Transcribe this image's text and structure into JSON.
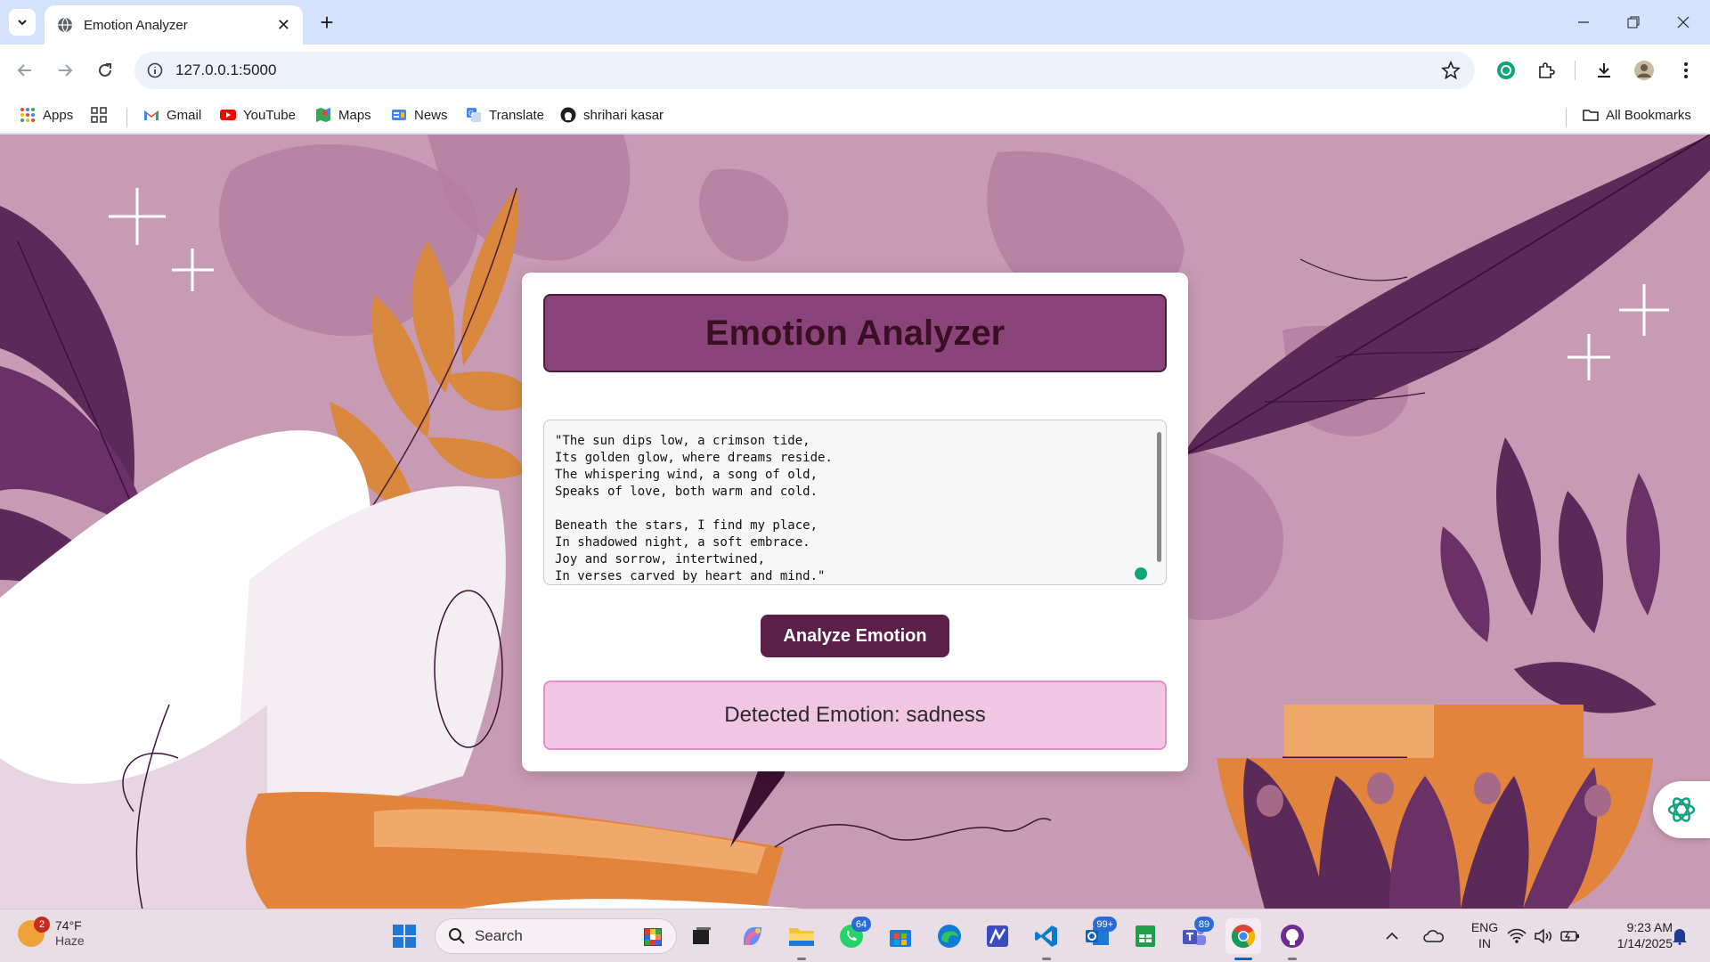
{
  "browser": {
    "tab_title": "Emotion Analyzer",
    "url": "127.0.0.1:5000",
    "bookmarks": [
      {
        "label": "Apps",
        "icon": "apps-grid-icon"
      },
      {
        "label": "Gmail",
        "icon": "gmail-icon"
      },
      {
        "label": "YouTube",
        "icon": "youtube-icon"
      },
      {
        "label": "Maps",
        "icon": "maps-icon"
      },
      {
        "label": "News",
        "icon": "news-icon"
      },
      {
        "label": "Translate",
        "icon": "translate-icon"
      },
      {
        "label": "shrihari kasar",
        "icon": "github-icon"
      }
    ],
    "all_bookmarks": "All Bookmarks"
  },
  "page": {
    "title": "Emotion Analyzer",
    "input_text": "\"The sun dips low, a crimson tide,\nIts golden glow, where dreams reside.\nThe whispering wind, a song of old,\nSpeaks of love, both warm and cold.\n\nBeneath the stars, I find my place,\nIn shadowed night, a soft embrace.\nJoy and sorrow, intertwined,\nIn verses carved by heart and mind.\"",
    "analyze_button": "Analyze Emotion",
    "result": "Detected Emotion: sadness",
    "colors": {
      "header_bg": "#8a4479",
      "button_bg": "#5c1f4a",
      "result_bg": "#f0c6e2"
    }
  },
  "taskbar": {
    "weather_temp": "74°F",
    "weather_desc": "Haze",
    "weather_badge": "2",
    "search_label": "Search",
    "whatsapp_badge": "64",
    "outlook_badge": "99+",
    "teams_badge": "89",
    "lang_top": "ENG",
    "lang_bottom": "IN",
    "time": "9:23 AM",
    "date": "1/14/2025"
  }
}
